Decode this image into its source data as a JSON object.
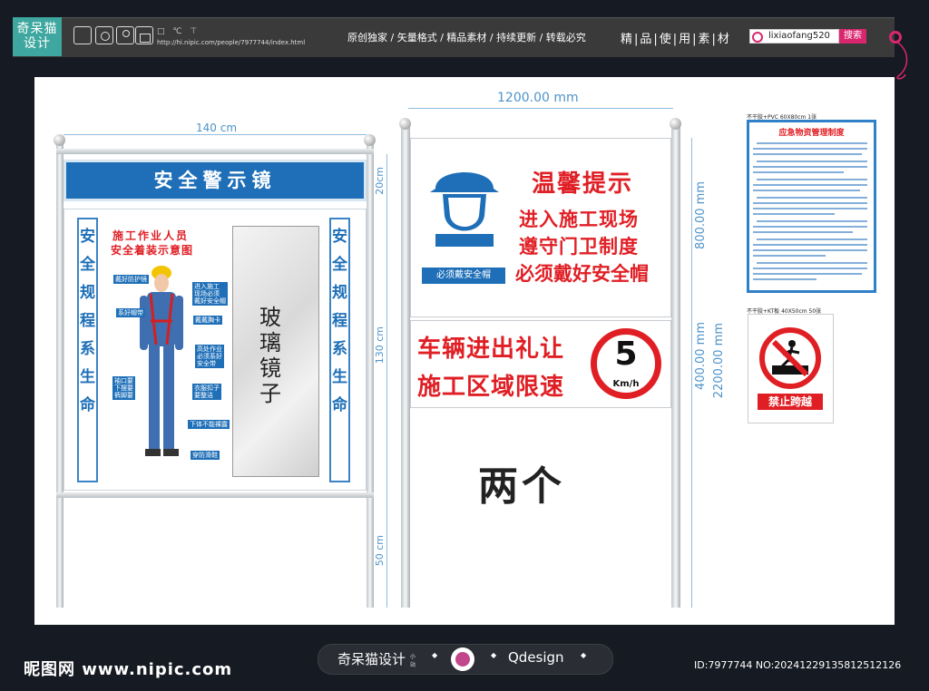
{
  "topbar": {
    "logo_line1": "奇呆猫",
    "logo_line2": "设计",
    "small_icons": "□ ℃ ⊤",
    "url": "http://hi.nipic.com/people/7977744/index.html",
    "slogan": "原创独家 / 矢量格式 / 精品素材 / 持续更新 / 转载必究",
    "jingpin": "精|品|使|用|素|材",
    "search_value": "lixiaofang520",
    "search_button": "搜索"
  },
  "dimensions": {
    "width_140": "140 cm",
    "h_20": "20cm",
    "h_130": "130 cm",
    "h_50": "50 cm",
    "width_1200": "1200.00 mm",
    "h_800": "800.00 mm",
    "h_400": "400.00 mm",
    "h_2200": "2200.00 mm"
  },
  "mirror": {
    "title": "安全警示镜",
    "left_vertical": [
      "安",
      "全",
      "规",
      "程",
      "系",
      "生",
      "命"
    ],
    "right_vertical": [
      "安",
      "全",
      "规",
      "程",
      "系",
      "生",
      "命"
    ],
    "diagram_title_1": "施工作业人员",
    "diagram_title_2": "安全着装示意图",
    "callouts_left": [
      "戴好防护镜",
      "系好帽带",
      "袖口要\n下摆要\n裤脚要"
    ],
    "callouts_right": [
      "进入施工\n现场必须\n戴好安全帽",
      "戴戴胸卡",
      "高处作业\n必须系好\n安全带",
      "衣服扣子\n要整洁",
      "下体不能裸露",
      "穿防滑鞋"
    ],
    "glass_text": "玻璃镜子"
  },
  "sign": {
    "helmet_label": "必须戴安全帽",
    "title": "温馨提示",
    "lines": [
      "进入施工现场",
      "遵守门卫制度",
      "必须戴好安全帽"
    ],
    "speed_lines": [
      "车辆进出礼让",
      "施工区域限速"
    ],
    "speed_value": "5",
    "speed_unit": "Km/h",
    "quantity": "两个"
  },
  "board1": {
    "caption": "不干胶+PVC 60X80cm 1张",
    "title": "应急物资管理制度"
  },
  "board2": {
    "caption": "不干胶+KT板 40X50cm 50张",
    "label": "禁止跨越"
  },
  "footer": {
    "site": "昵图网 www.nipic.com",
    "brand": "奇呆猫设计",
    "brand_sub": "小站",
    "qdesign": "Qdesign",
    "id": "ID:7977744 NO:20241229135812512126"
  },
  "colors": {
    "blue": "#1e6fb8",
    "red": "#e01f25",
    "teal": "#3ea79f",
    "pink": "#d9266e"
  }
}
